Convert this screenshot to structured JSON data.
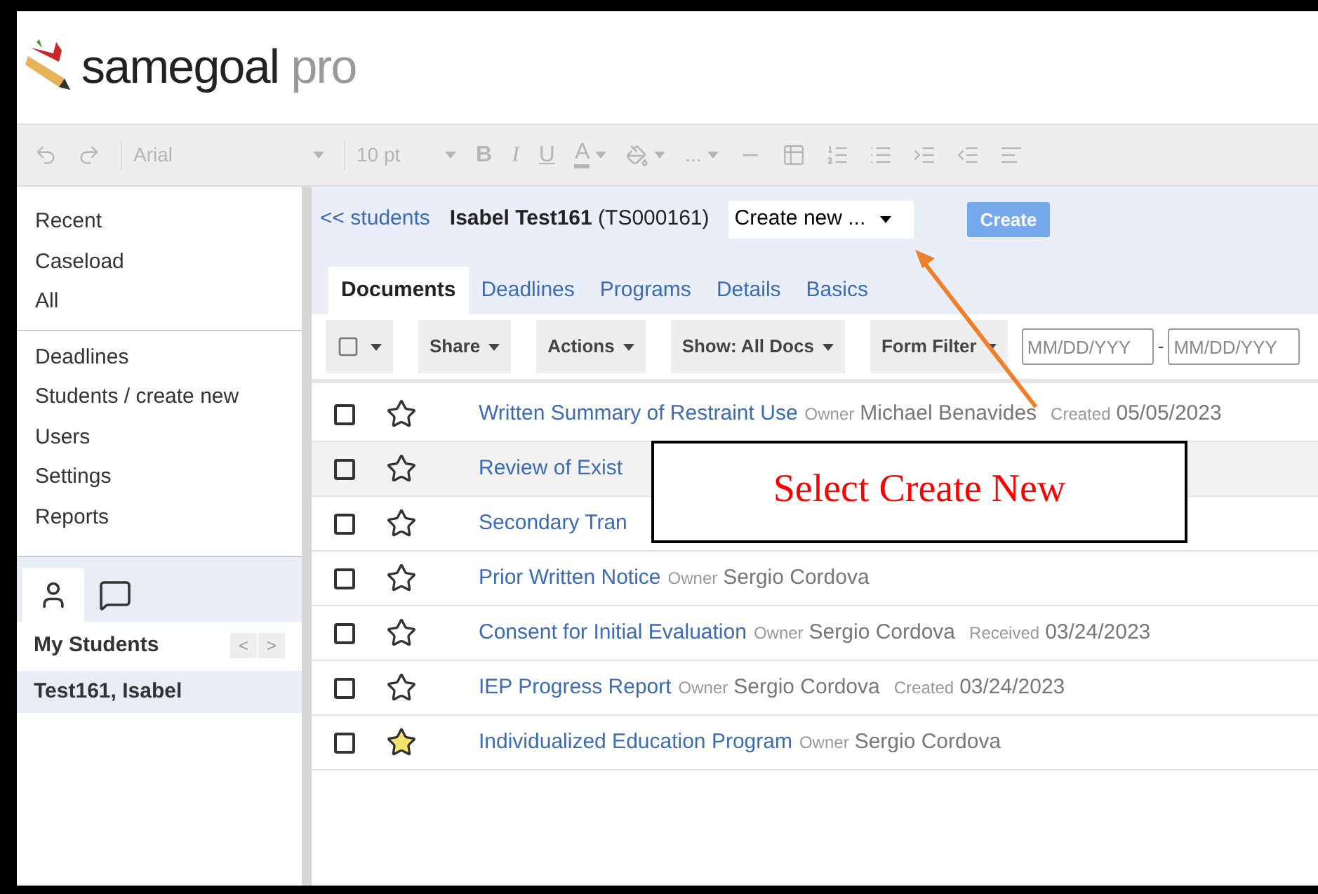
{
  "logo": {
    "name": "samegoal",
    "suffix": "pro"
  },
  "toolbar": {
    "font": "Arial",
    "size": "10 pt",
    "bold": "B",
    "italic": "I",
    "underline": "U",
    "swatch_letter": "A",
    "more": "..."
  },
  "sidebar": {
    "groups": [
      [
        "Recent",
        "Caseload",
        "All"
      ],
      [
        "Deadlines",
        "Students / create new",
        "Users",
        "Settings",
        "Reports"
      ]
    ],
    "panel_tabs": [
      {
        "kind": "person",
        "selected": true
      },
      {
        "kind": "chat",
        "selected": false
      }
    ],
    "list_title": "My Students",
    "prev": "<",
    "next": ">",
    "students": [
      {
        "name": "Test161, Isabel",
        "selected": true
      }
    ]
  },
  "student_bar": {
    "back_link": "<< students",
    "student_name": "Isabel Test161",
    "student_id": "(TS000161)",
    "create_select": "Create new ...",
    "create_button": "Create"
  },
  "tabs": [
    {
      "label": "Documents",
      "selected": true
    },
    {
      "label": "Deadlines",
      "selected": false
    },
    {
      "label": "Programs",
      "selected": false
    },
    {
      "label": "Details",
      "selected": false
    },
    {
      "label": "Basics",
      "selected": false
    }
  ],
  "doc_toolbar": {
    "share": "Share",
    "actions": "Actions",
    "show": "Show: All Docs",
    "form_filter": "Form Filter",
    "date_from": {
      "placeholder": "MM/DD/YYY"
    },
    "date_sep": "-",
    "date_to": {
      "placeholder": "MM/DD/YYY"
    }
  },
  "documents": [
    {
      "title": "Written Summary of Restraint Use",
      "owner_label": "Owner",
      "owner": "Michael Benavides",
      "date_label": "Created",
      "date": "05/05/2023",
      "checked": false,
      "starred": false,
      "highlighted": false
    },
    {
      "title": "Review of Exist",
      "checked": false,
      "starred": false,
      "highlighted": true
    },
    {
      "title": "Secondary Tran",
      "checked": false,
      "starred": false,
      "highlighted": false
    },
    {
      "title": "Prior Written Notice",
      "owner_label": "Owner",
      "owner": "Sergio Cordova",
      "checked": false,
      "starred": false,
      "highlighted": false
    },
    {
      "title": "Consent for Initial Evaluation",
      "owner_label": "Owner",
      "owner": "Sergio Cordova",
      "date_label": "Received",
      "date": "03/24/2023",
      "checked": false,
      "starred": false,
      "highlighted": false
    },
    {
      "title": "IEP Progress Report",
      "owner_label": "Owner",
      "owner": "Sergio Cordova",
      "date_label": "Created",
      "date": "03/24/2023",
      "checked": false,
      "starred": false,
      "highlighted": false
    },
    {
      "title": "Individualized Education Program",
      "owner_label": "Owner",
      "owner": "Sergio Cordova",
      "checked": false,
      "starred": true,
      "highlighted": false
    }
  ],
  "callout": {
    "text": "Select Create New"
  }
}
